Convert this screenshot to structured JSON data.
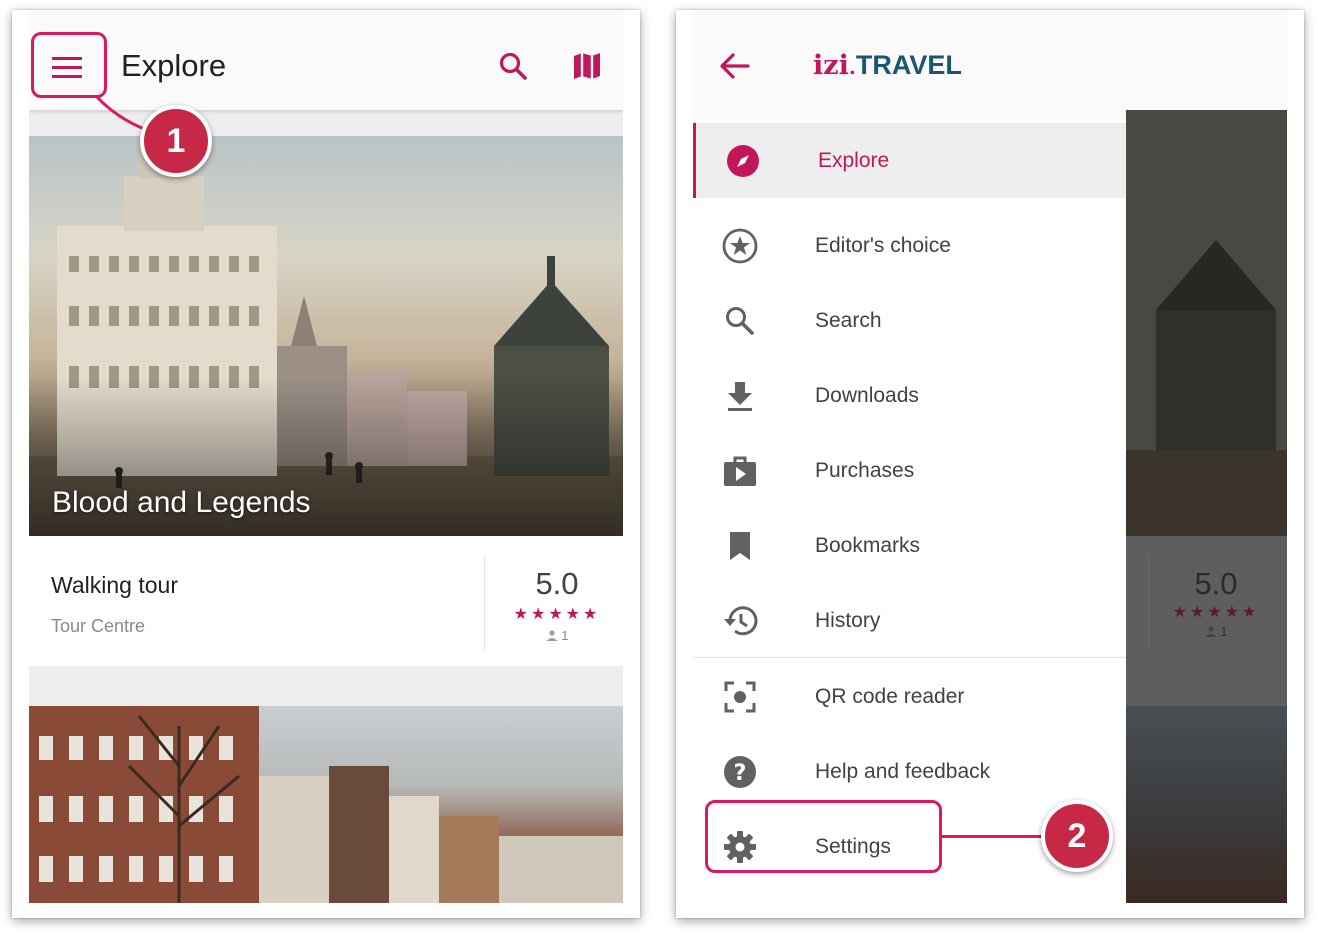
{
  "left_screen": {
    "app_bar": {
      "title": "Explore",
      "icons": [
        "menu-icon",
        "search-icon",
        "map-icon"
      ]
    },
    "featured_card": {
      "title": "Blood and Legends",
      "type": "Walking tour",
      "author": "Tour Centre",
      "rating": "5.0",
      "stars": "★★★★★",
      "reviews": "1"
    },
    "callout": {
      "number": "1"
    }
  },
  "right_screen": {
    "app_bar": {
      "logo_prefix": "izi",
      "logo_dot": ".",
      "logo_suffix": "TRAVEL",
      "icons": [
        "back-arrow-icon"
      ]
    },
    "drawer": {
      "items": [
        {
          "label": "Explore",
          "icon": "compass-icon",
          "active": true
        },
        {
          "label": "Editor's choice",
          "icon": "star-circle-icon",
          "active": false
        },
        {
          "label": "Search",
          "icon": "search-icon",
          "active": false
        },
        {
          "label": "Downloads",
          "icon": "download-icon",
          "active": false
        },
        {
          "label": "Purchases",
          "icon": "purchases-icon",
          "active": false
        },
        {
          "label": "Bookmarks",
          "icon": "bookmark-icon",
          "active": false
        },
        {
          "label": "History",
          "icon": "history-icon",
          "active": false
        },
        {
          "label": "QR code reader",
          "icon": "qr-scan-icon",
          "active": false
        },
        {
          "label": "Help and feedback",
          "icon": "help-icon",
          "active": false
        },
        {
          "label": "Settings",
          "icon": "gear-icon",
          "active": false
        }
      ]
    },
    "backdrop_card": {
      "rating": "5.0",
      "stars": "★★★★★",
      "reviews": "1"
    },
    "callout": {
      "number": "2"
    }
  },
  "colors": {
    "accent": "#c2185b",
    "callout": "#d81b60",
    "badge": "#c62846",
    "logo_blue": "#1c5570"
  }
}
